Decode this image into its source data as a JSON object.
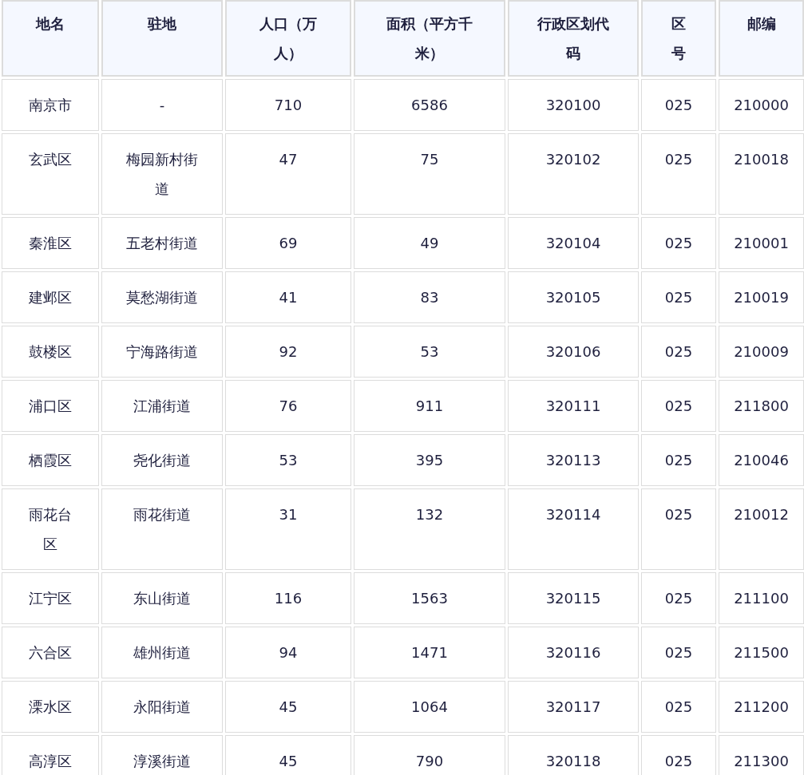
{
  "table": {
    "columns": [
      "地名",
      "驻地",
      "人口（万人）",
      "面积（平方千米）",
      "行政区划代码",
      "区号",
      "邮编"
    ],
    "rows": [
      [
        "南京市",
        "-",
        "710",
        "6586",
        "320100",
        "025",
        "210000"
      ],
      [
        "玄武区",
        "梅园新村街道",
        "47",
        "75",
        "320102",
        "025",
        "210018"
      ],
      [
        "秦淮区",
        "五老村街道",
        "69",
        "49",
        "320104",
        "025",
        "210001"
      ],
      [
        "建邺区",
        "莫愁湖街道",
        "41",
        "83",
        "320105",
        "025",
        "210019"
      ],
      [
        "鼓楼区",
        "宁海路街道",
        "92",
        "53",
        "320106",
        "025",
        "210009"
      ],
      [
        "浦口区",
        "江浦街道",
        "76",
        "911",
        "320111",
        "025",
        "211800"
      ],
      [
        "栖霞区",
        "尧化街道",
        "53",
        "395",
        "320113",
        "025",
        "210046"
      ],
      [
        "雨花台区",
        "雨花街道",
        "31",
        "132",
        "320114",
        "025",
        "210012"
      ],
      [
        "江宁区",
        "东山街道",
        "116",
        "1563",
        "320115",
        "025",
        "211100"
      ],
      [
        "六合区",
        "雄州街道",
        "94",
        "1471",
        "320116",
        "025",
        "211500"
      ],
      [
        "溧水区",
        "永阳街道",
        "45",
        "1064",
        "320117",
        "025",
        "211200"
      ],
      [
        "高淳区",
        "淳溪街道",
        "45",
        "790",
        "320118",
        "025",
        "211300"
      ]
    ]
  }
}
